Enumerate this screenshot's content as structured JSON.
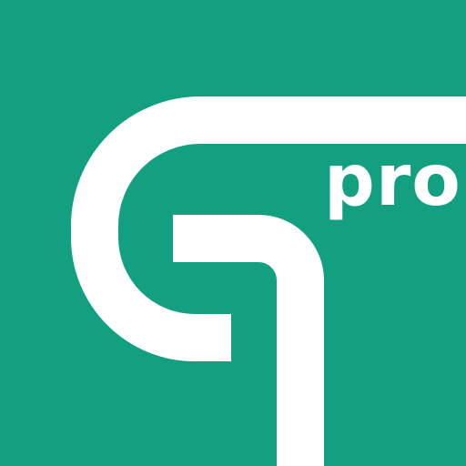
{
  "logo": {
    "badge": "pro",
    "background_color": "#12A081",
    "mark_color": "#FFFFFF",
    "icon_name": "hook-route-logo-icon"
  }
}
